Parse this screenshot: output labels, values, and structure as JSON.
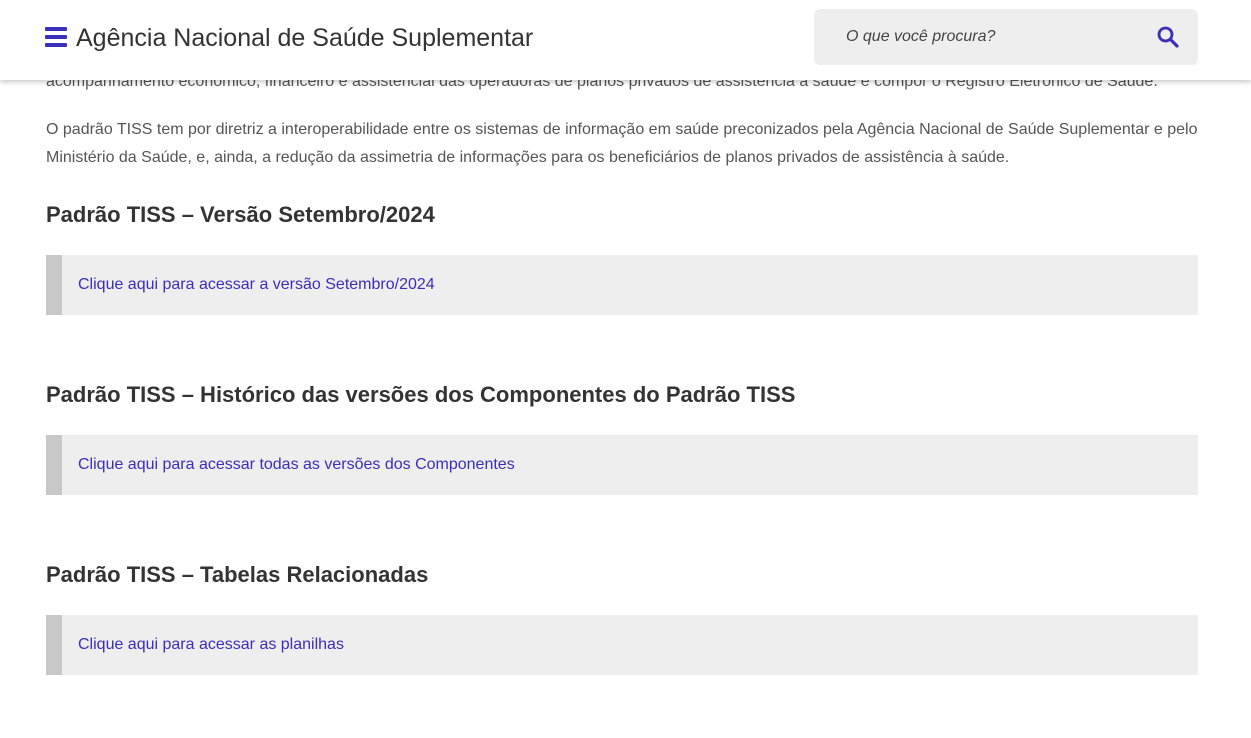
{
  "header": {
    "site_title": "Agência Nacional de Saúde Suplementar",
    "search_placeholder": "O que você procura?",
    "accent_color": "#3a2fb8"
  },
  "main": {
    "partial_paragraph": "acompanhamento econômico, financeiro e assistencial das operadoras de planos privados de assistência à saúde e compor o Registro Eletrônico de Saúde.",
    "paragraph": "O padrão TISS tem por diretriz a interoperabilidade entre os sistemas de informação em saúde preconizados pela Agência Nacional de Saúde Suplementar e pelo Ministério da Saúde, e, ainda, a redução da assimetria de informações para os beneficiários de planos privados de assistência à saúde.",
    "sections": [
      {
        "title": "Padrão TISS – Versão Setembro/2024",
        "link_text": "Clique aqui para acessar a versão Setembro/2024"
      },
      {
        "title": "Padrão TISS – Histórico das versões dos Componentes do Padrão TISS",
        "link_text": "Clique aqui para acessar todas as versões dos Componentes"
      },
      {
        "title": "Padrão TISS – Tabelas Relacionadas",
        "link_text": "Clique aqui para acessar as planilhas"
      }
    ]
  },
  "icons": {
    "menu": "hamburger-menu-icon",
    "search": "search-icon"
  }
}
